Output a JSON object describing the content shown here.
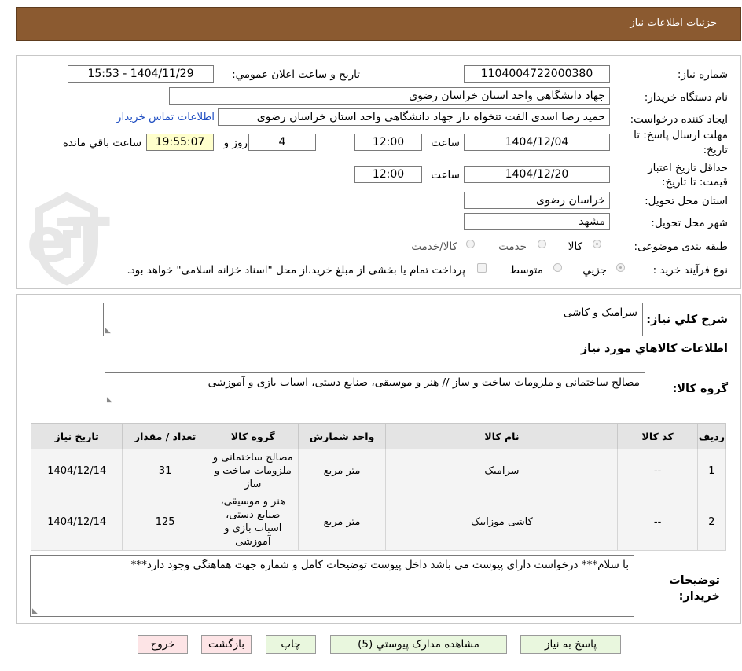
{
  "header": {
    "title": "جزئیات اطلاعات نیاز"
  },
  "watermark": {
    "text": "AriaTender.neT"
  },
  "form": {
    "need_number_label": "شماره نیاز:",
    "need_number": "1104004722000380",
    "announce_label": "تاریخ و ساعت اعلان عمومي:",
    "announce_value": "1404/11/29 - 15:53",
    "buyer_org_label": "نام دستگاه خريدار:",
    "buyer_org": "جهاد دانشگاهی واحد استان خراسان رضوی",
    "requester_label": "ايجاد کننده درخواست:",
    "requester": "حمید رضا اسدی الفت تنخواه دار جهاد دانشگاهی واحد استان خراسان رضوی",
    "contact_link": "اطلاعات تماس خريدار",
    "deadline_label_1": "مهلت ارسال پاسخ: تا",
    "deadline_label_2": "تاريخ:",
    "deadline_date": "1404/12/04",
    "time_label": "ساعت",
    "deadline_time": "12:00",
    "days_value": "4",
    "days_label": "روز و",
    "remaining_time": "19:55:07",
    "remaining_label": "ساعت باقي مانده",
    "price_label_1": "حداقل تاريخ اعتبار",
    "price_label_2": "قيمت: تا تاريخ:",
    "price_date": "1404/12/20",
    "price_time_label": "ساعت",
    "price_time": "12:00",
    "province_label": "استان محل تحويل:",
    "province": "خراسان رضوی",
    "city_label": "شهر محل تحويل:",
    "city": "مشهد",
    "category_label": "طبقه بندی موضوعی:",
    "category_options": [
      "کالا",
      "خدمت",
      "کالا/خدمت"
    ],
    "category_selected": "کالا",
    "process_label": "نوع فرآيند خريد :",
    "process_options": [
      "جزيي",
      "متوسط"
    ],
    "process_selected": "جزيي",
    "payment_note": "پرداخت تمام يا بخشی از مبلغ خريد،از محل \"اسناد خزانه اسلامی\" خواهد بود."
  },
  "summary": {
    "label": "شرح کلي نياز:",
    "value": "سرامیک و کاشی"
  },
  "goods_section_title": "اطلاعات کالاهاي مورد نياز",
  "goods_group": {
    "label": "گروه کالا:",
    "value": "مصالح ساختمانی و ملزومات ساخت و ساز // هنر و موسیقی، صنایع دستی، اسباب بازی و آموزشی"
  },
  "table": {
    "headers": [
      "رديف",
      "کد کالا",
      "نام کالا",
      "واحد شمارش",
      "گروه کالا",
      "تعداد / مقدار",
      "تاريخ نياز"
    ],
    "rows": [
      [
        "1",
        "--",
        "سرامیک",
        "متر مربع",
        "مصالح ساختمانی و ملزومات ساخت و ساز",
        "31",
        "1404/12/14"
      ],
      [
        "2",
        "--",
        "کاشی موزاییک",
        "متر مربع",
        "هنر و موسیقی، صنایع دستی، اسباب بازی و آموزشی",
        "125",
        "1404/12/14"
      ]
    ]
  },
  "buyer_notes": {
    "label": "توضيحات خريدار:",
    "value": "با سلام*** درخواست دارای پیوست می باشد داخل پیوست توضیحات کامل و شماره جهت هماهنگی وجود دارد***"
  },
  "buttons": {
    "reply": "پاسخ به نياز",
    "attachments": "مشاهده مدارک پيوستي (5)",
    "print": "چاپ",
    "back": "بازگشت",
    "exit": "خروج"
  },
  "colors": {
    "header_bg": "#8b5a30",
    "link": "#1f4ec2",
    "button_green": "#e9f7de",
    "button_pink": "#fde4e6",
    "remaining_bg": "#ffffcc"
  }
}
